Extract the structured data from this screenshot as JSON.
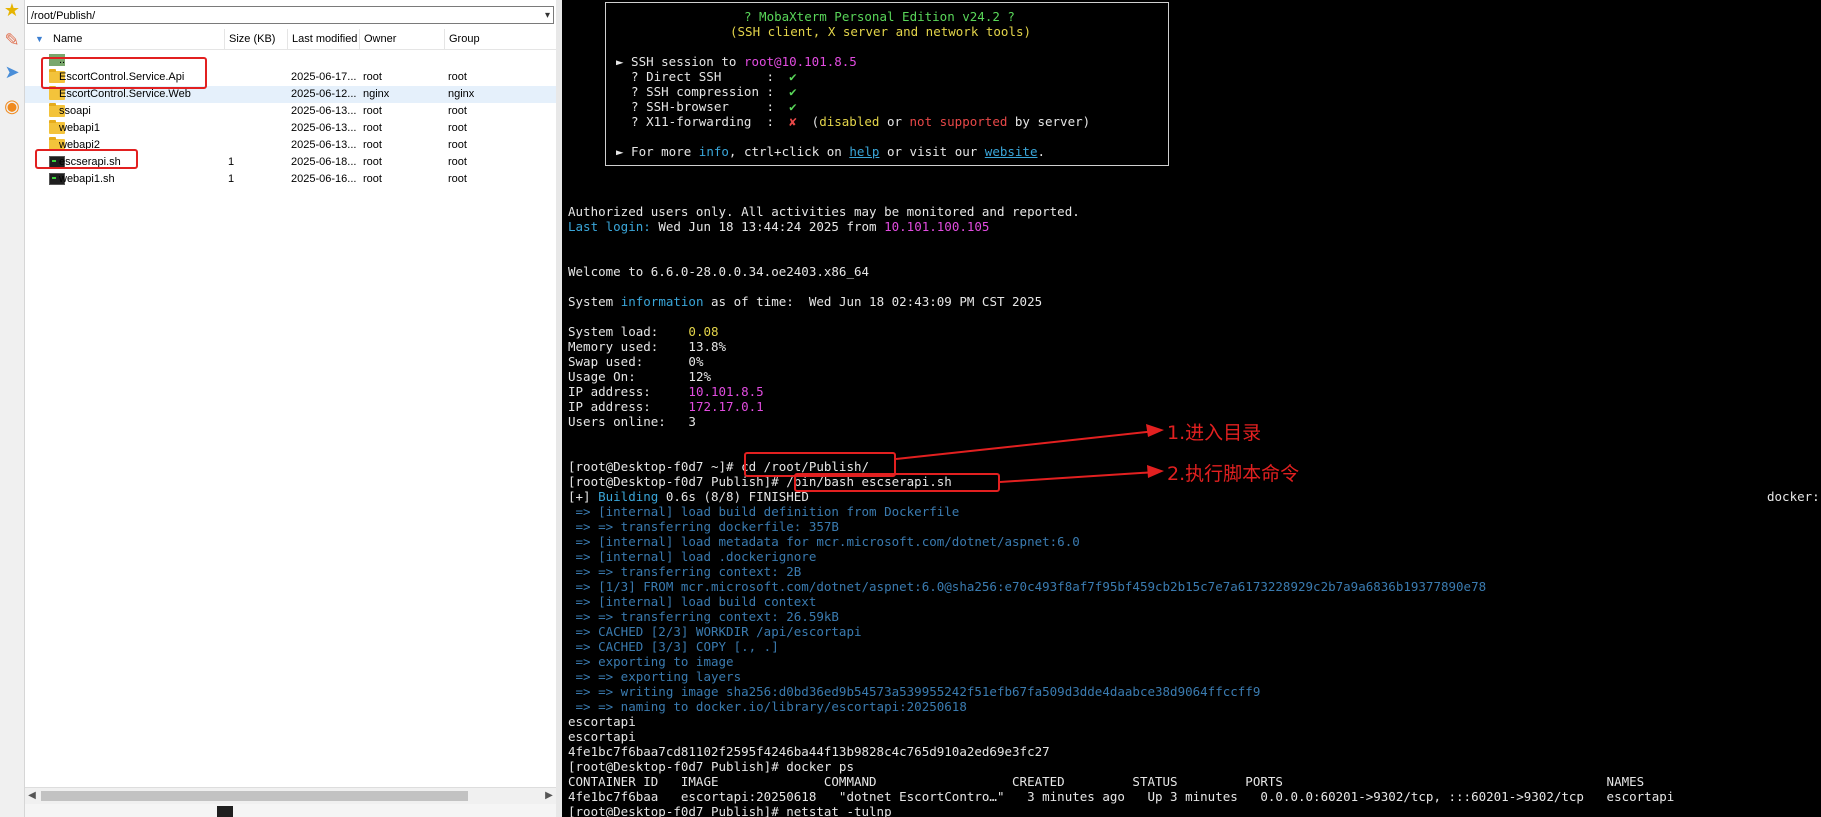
{
  "sftp": {
    "path": "/root/Publish/",
    "columns": [
      "Name",
      "Size (KB)",
      "Last modified",
      "Owner",
      "Group"
    ],
    "files": [
      {
        "icon": "parent-folder-icon",
        "name": "..",
        "size": "",
        "modified": "",
        "owner": "",
        "group": ""
      },
      {
        "icon": "folder-icon",
        "name": "EscortControl.Service.Api",
        "size": "",
        "modified": "2025-06-17...",
        "owner": "root",
        "group": "root"
      },
      {
        "icon": "folder-icon",
        "name": "EscortControl.Service.Web",
        "size": "",
        "modified": "2025-06-12...",
        "owner": "nginx",
        "group": "nginx"
      },
      {
        "icon": "folder-icon",
        "name": "ssoapi",
        "size": "",
        "modified": "2025-06-13...",
        "owner": "root",
        "group": "root"
      },
      {
        "icon": "folder-icon",
        "name": "webapi1",
        "size": "",
        "modified": "2025-06-13...",
        "owner": "root",
        "group": "root"
      },
      {
        "icon": "folder-icon",
        "name": "webapi2",
        "size": "",
        "modified": "2025-06-13...",
        "owner": "root",
        "group": "root"
      },
      {
        "icon": "script-icon",
        "name": "escserapi.sh",
        "size": "1",
        "modified": "2025-06-18...",
        "owner": "root",
        "group": "root"
      },
      {
        "icon": "script-icon",
        "name": "webapi1.sh",
        "size": "1",
        "modified": "2025-06-16...",
        "owner": "root",
        "group": "root"
      }
    ]
  },
  "banner": {
    "title": "? MobaXterm Personal Edition v24.2 ?",
    "subtitle": "(SSH client, X server and network tools)",
    "ssh_label": "► SSH session to ",
    "ssh_host": "root@10.101.8.5",
    "opts": [
      {
        "label": "  ? Direct SSH      :  ",
        "mark": "✔"
      },
      {
        "label": "  ? SSH compression :  ",
        "mark": "✔"
      },
      {
        "label": "  ? SSH-browser     :  ",
        "mark": "✔"
      }
    ],
    "x11_label": "  ? X11-forwarding  :  ",
    "x11_mark": "✘",
    "x11_open": "  (",
    "x11_disabled": "disabled",
    "x11_or": " or ",
    "x11_notsupported": "not supported",
    "x11_end": " by server)",
    "more_pre": "► For more ",
    "more_info": "info",
    "more_mid": ", ctrl+click on ",
    "more_help": "help",
    "more_mid2": " or visit our ",
    "more_site": "website",
    "more_end": "."
  },
  "terminal": {
    "authorized": "Authorized users only. All activities may be monitored and reported.",
    "lastlogin_label": "Last login:",
    "lastlogin_time": " Wed Jun 18 13:44:24 2025 from ",
    "lastlogin_ip": "10.101.100.105",
    "welcome": "Welcome to 6.6.0-28.0.0.34.oe2403.x86_64",
    "sysinfo_pre": "System ",
    "sysinfo_word": "information",
    "sysinfo_post": " as of time:  Wed Jun 18 02:43:09 PM CST 2025",
    "stats": [
      {
        "label": "System load:    ",
        "value": "0.08",
        "color": "yellow"
      },
      {
        "label": "Memory used:    ",
        "value": "13.8%",
        "color": "white"
      },
      {
        "label": "Swap used:      ",
        "value": "0%",
        "color": "white"
      },
      {
        "label": "Usage On:       ",
        "value": "12%",
        "color": "white"
      },
      {
        "label": "IP address:     ",
        "value": "10.101.8.5",
        "color": "magenta"
      },
      {
        "label": "IP address:     ",
        "value": "172.17.0.1",
        "color": "magenta"
      },
      {
        "label": "Users online:   ",
        "value": "3",
        "color": "white"
      }
    ],
    "prompt1": "[root@Desktop-f0d7 ~]# ",
    "cmd1": "cd /root/Publish/",
    "prompt2": "[root@Desktop-f0d7 Publish]# ",
    "cmd2": "/bin/bash escserapi.sh",
    "build_pre": "[+] ",
    "build_word": "Building",
    "build_post": " 0.6s (8/8) FINISHED",
    "build_right": "docker:",
    "build_lines": [
      " => [internal] load build definition from Dockerfile",
      " => => transferring dockerfile: 357B",
      " => [internal] load metadata for mcr.microsoft.com/dotnet/aspnet:6.0",
      " => [internal] load .dockerignore",
      " => => transferring context: 2B",
      " => [1/3] FROM mcr.microsoft.com/dotnet/aspnet:6.0@sha256:e70c493f8af7f95bf459cb2b15c7e7a6173228929c2b7a9a6836b19377890e78",
      " => [internal] load build context",
      " => => transferring context: 26.59kB",
      " => CACHED [2/3] WORKDIR /api/escortapi",
      " => CACHED [3/3] COPY [., .]",
      " => exporting to image",
      " => => exporting layers",
      " => => writing image sha256:d0bd36ed9b54573a539955242f51efb67fa509d3dde4daabce38d9064ffccff9",
      " => => naming to docker.io/library/escortapi:20250618"
    ],
    "out_lines": [
      "escortapi",
      "escortapi",
      "4fe1bc7f6baa7cd81102f2595f4246ba44f13b9828c4c765d910a2ed69e3fc27"
    ],
    "prompt3": "[root@Desktop-f0d7 Publish]# docker ps",
    "ps_header": "CONTAINER ID   IMAGE              COMMAND                  CREATED         STATUS         PORTS                                           NAMES",
    "ps_row": "4fe1bc7f6baa   escortapi:20250618   \"dotnet EscortContro…\"   3 minutes ago   Up 3 minutes   0.0.0.0:60201->9302/tcp, :::60201->9302/tcp   escortapi",
    "prompt4": "[root@Desktop-f0d7 Publish]# netstat -tulnp"
  },
  "annotations": {
    "step1": "1.进入目录",
    "step2": "2.执行脚本命令",
    "color": "#e22020"
  },
  "colors": {
    "terminal_bg": "#000000",
    "green": "#59d659",
    "yellow": "#e3d44a",
    "magenta": "#e24ce0",
    "cyan": "#3aa6d9",
    "red": "#e84848"
  }
}
